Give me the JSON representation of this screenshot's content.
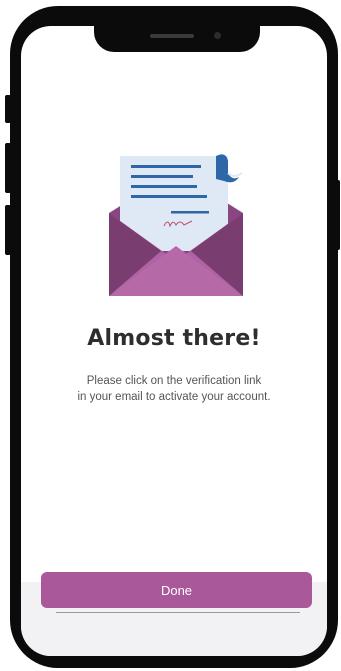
{
  "screen": {
    "title": "Almost there!",
    "message_line1": "Please click on the verification link",
    "message_line2": "in your email to activate your account.",
    "done_label": "Done"
  },
  "colors": {
    "accent": "#a9589a",
    "envelope": "#a9589a",
    "envelope_dark": "#7a3d6f",
    "letter": "#dfe9f6",
    "letter_lines": "#2e67a8",
    "title_text": "#2e2e2e",
    "body_text": "#555555"
  },
  "icons": {
    "illustration": "envelope-with-letter-icon"
  }
}
